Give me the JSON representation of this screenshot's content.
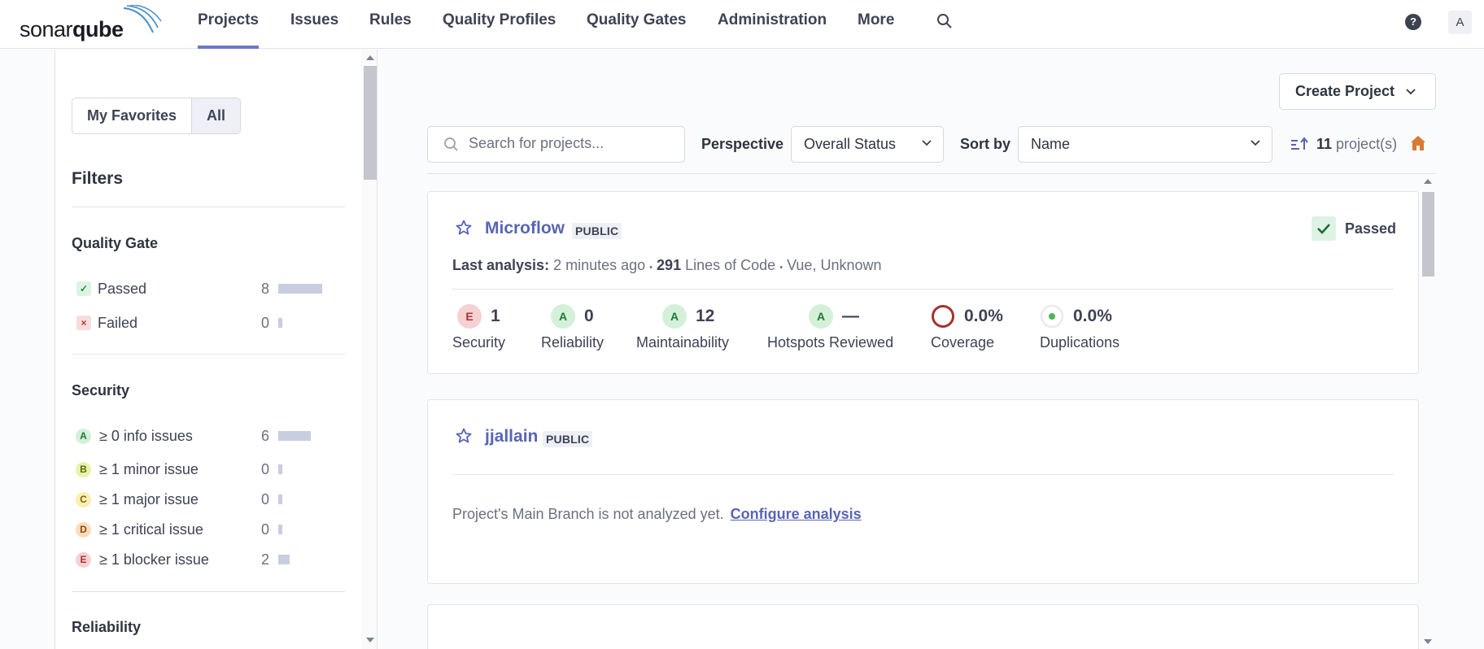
{
  "brand": {
    "light": "sonar",
    "bold": "qube"
  },
  "nav": [
    {
      "label": "Projects",
      "active": true
    },
    {
      "label": "Issues"
    },
    {
      "label": "Rules"
    },
    {
      "label": "Quality Profiles"
    },
    {
      "label": "Quality Gates"
    },
    {
      "label": "Administration"
    },
    {
      "label": "More"
    }
  ],
  "header": {
    "help": "?",
    "avatar": "A"
  },
  "sidebar": {
    "toggle": {
      "favorites": "My Favorites",
      "all": "All",
      "selected": "All"
    },
    "filters_title": "Filters",
    "quality_gate": {
      "title": "Quality Gate",
      "items": [
        {
          "label": "Passed",
          "count": "8",
          "icon": "check-icon"
        },
        {
          "label": "Failed",
          "count": "0",
          "icon": "x-icon"
        }
      ]
    },
    "security": {
      "title": "Security",
      "items": [
        {
          "rating": "A",
          "label": "≥ 0 info issues",
          "count": "6"
        },
        {
          "rating": "B",
          "label": "≥ 1 minor issue",
          "count": "0"
        },
        {
          "rating": "C",
          "label": "≥ 1 major issue",
          "count": "0"
        },
        {
          "rating": "D",
          "label": "≥ 1 critical issue",
          "count": "0"
        },
        {
          "rating": "E",
          "label": "≥ 1 blocker issue",
          "count": "2"
        }
      ]
    },
    "reliability_title": "Reliability"
  },
  "toolbar": {
    "create_project": "Create Project",
    "search_placeholder": "Search for projects...",
    "perspective_label": "Perspective",
    "perspective_value": "Overall Status",
    "sort_label": "Sort by",
    "sort_value": "Name",
    "count": "11",
    "count_suffix": "project(s)"
  },
  "projects": [
    {
      "name": "Microflow",
      "visibility": "PUBLIC",
      "quality_gate": "Passed",
      "last_analysis_label": "Last analysis:",
      "last_analysis": "2 minutes ago",
      "sep": "•",
      "loc": "291",
      "loc_label": "Lines of Code",
      "languages": "Vue, Unknown",
      "metrics": [
        {
          "rating": "E",
          "value": "1",
          "label": "Security"
        },
        {
          "rating": "A",
          "value": "0",
          "label": "Reliability"
        },
        {
          "rating": "A",
          "value": "12",
          "label": "Maintainability"
        },
        {
          "rating": "A",
          "value": "—",
          "label": "Hotspots Reviewed"
        },
        {
          "value": "0.0%",
          "label": "Coverage"
        },
        {
          "value": "0.0%",
          "label": "Duplications"
        }
      ]
    },
    {
      "name": "jjallain",
      "visibility": "PUBLIC",
      "not_analyzed": "Project's Main Branch is not analyzed yet.",
      "configure": "Configure analysis"
    }
  ],
  "colors": {
    "accent": "#5964b5",
    "nav_underline": "#6c78c5",
    "passed": "#1d8a3a",
    "coverage_ring": "#a8322a"
  }
}
